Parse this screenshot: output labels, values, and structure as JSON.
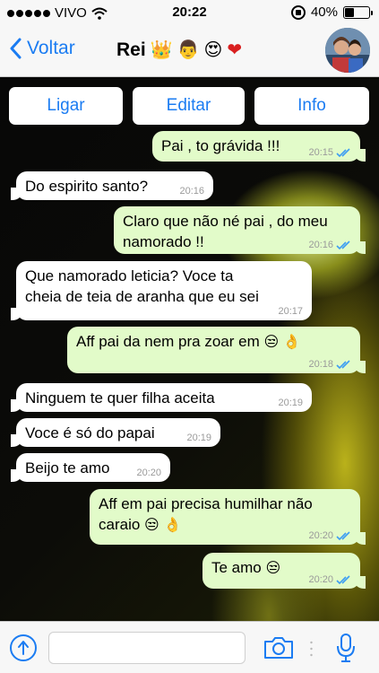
{
  "status": {
    "carrier": "VIVO",
    "time": "20:22",
    "battery": "40%",
    "battery_level": 0.4
  },
  "nav": {
    "back_label": "Voltar",
    "title": "Rei",
    "title_emojis": [
      "👑",
      "👨",
      "😍",
      "❤"
    ]
  },
  "actions": [
    {
      "label": "Ligar"
    },
    {
      "label": "Editar"
    },
    {
      "label": "Info"
    }
  ],
  "messages": [
    {
      "side": "out",
      "lines": [
        "Pai , to grávida !!!"
      ],
      "time": "20:15"
    },
    {
      "side": "in",
      "lines": [
        "Do espirito santo?"
      ],
      "time": "20:16"
    },
    {
      "side": "out",
      "lines": [
        "Claro que não né pai , do meu",
        "namorado !!"
      ],
      "time": "20:16"
    },
    {
      "side": "in",
      "lines": [
        "Que namorado leticia? Voce ta",
        "cheia de teia de aranha que eu sei"
      ],
      "time": "20:17"
    },
    {
      "side": "out",
      "lines": [
        "Aff pai da nem pra zoar em"
      ],
      "emojis": [
        "😒",
        "👌"
      ],
      "time": "20:18"
    },
    {
      "side": "in",
      "lines": [
        "Ninguem te quer filha aceita"
      ],
      "time": "20:19"
    },
    {
      "side": "in",
      "lines": [
        "Voce é só do papai"
      ],
      "time": "20:19"
    },
    {
      "side": "in",
      "lines": [
        "Beijo te amo"
      ],
      "time": "20:20"
    },
    {
      "side": "out",
      "lines": [
        "Aff em pai precisa humilhar não",
        "caraio"
      ],
      "emojis": [
        "😒",
        "👌"
      ],
      "time": "20:20"
    },
    {
      "side": "out",
      "lines": [
        "Te amo"
      ],
      "emojis": [
        "😒"
      ],
      "time": "20:20"
    }
  ],
  "colors": {
    "accent": "#1b7cf2",
    "outgoing_bubble": "#e2fbc9",
    "incoming_bubble": "#ffffff",
    "read_ticks": "#3d9df2"
  },
  "icons": [
    "signal-dots-icon",
    "wifi-icon",
    "rotation-lock-icon",
    "battery-icon",
    "back-chevron-icon",
    "share-icon",
    "camera-icon",
    "microphone-icon",
    "read-ticks-icon"
  ]
}
